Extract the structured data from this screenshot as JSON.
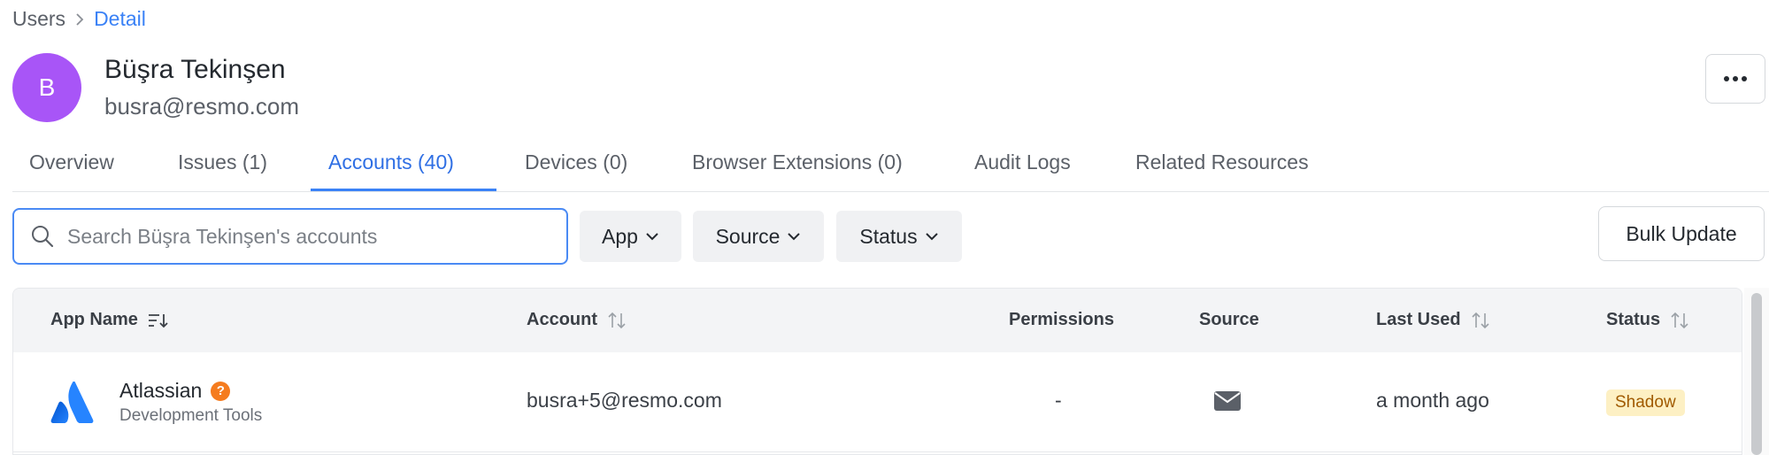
{
  "breadcrumb": {
    "parent": "Users",
    "current": "Detail"
  },
  "user": {
    "initial": "B",
    "name": "Büşra Tekinşen",
    "email": "busra@resmo.com"
  },
  "header": {
    "more_icon": "more-horizontal-icon"
  },
  "tabs": [
    {
      "label": "Overview"
    },
    {
      "label": "Issues (1)"
    },
    {
      "label": "Accounts (40)",
      "active": true
    },
    {
      "label": "Devices (0)"
    },
    {
      "label": "Browser Extensions (0)"
    },
    {
      "label": "Audit Logs"
    },
    {
      "label": "Related Resources"
    }
  ],
  "toolbar": {
    "search_placeholder": "Search Büşra Tekinşen's accounts",
    "search_value": "",
    "filters": [
      {
        "label": "App"
      },
      {
        "label": "Source"
      },
      {
        "label": "Status"
      }
    ],
    "bulk_update_label": "Bulk Update"
  },
  "table": {
    "columns": {
      "app_name": "App Name",
      "account": "Account",
      "permissions": "Permissions",
      "source": "Source",
      "last_used": "Last Used",
      "status": "Status"
    },
    "rows": [
      {
        "app_name": "Atlassian",
        "app_category": "Development Tools",
        "help_badge": "?",
        "account": "busra+5@resmo.com",
        "permissions": "-",
        "source_icon": "envelope-icon",
        "last_used": "a month ago",
        "status": "Shadow"
      }
    ]
  },
  "colors": {
    "accent": "#3b82f6",
    "avatar": "#a855f7",
    "atlassian_blue": "#2684ff",
    "shadow_badge_bg": "#fdf0c4",
    "shadow_badge_text": "#a05a00",
    "help_badge": "#f57c1f"
  }
}
